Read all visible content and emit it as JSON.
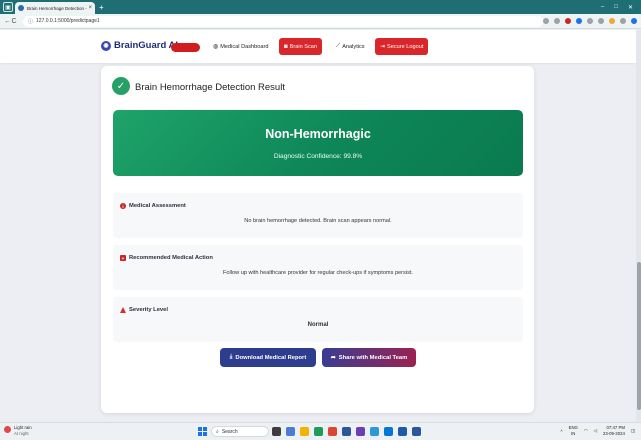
{
  "browser": {
    "tab_title": "Brain Hemorrhage Detection - B",
    "tab_close": "×",
    "new_tab": "+",
    "url": "127.0.0.1:5000/predictpage1",
    "nav_back": "←",
    "nav_reload": "C",
    "window_controls": {
      "minimize": "–",
      "maximize": "□",
      "close": "✕"
    }
  },
  "navbar": {
    "brand": "BrainGuard AI",
    "links": {
      "dashboard": "Medical Dashboard",
      "scan": "Brain Scan",
      "analytics": "Analytics",
      "logout": "Secure Logout"
    }
  },
  "result": {
    "title": "Brain Hemorrhage Detection Result",
    "prediction": "Non-Hemorrhagic",
    "confidence": "Diagnostic Confidence: 99.8%"
  },
  "sections": {
    "assessment": {
      "heading": "Medical Assessment",
      "text": "No brain hemorrhage detected. Brain scan appears normal."
    },
    "action": {
      "heading": "Recommended Medical Action",
      "text": "Follow up with healthcare provider for regular check-ups if symptoms persist."
    },
    "severity": {
      "heading": "Severity Level",
      "text": "Normal"
    }
  },
  "buttons": {
    "download": "Download Medical Report",
    "share": "Share with Medical Team"
  },
  "taskbar": {
    "weather_title": "Light rain",
    "weather_sub": "At night",
    "search_placeholder": "Search",
    "lang_top": "ENG",
    "lang_bottom": "IN",
    "time": "07:47 PM",
    "date": "23-09-2024"
  },
  "colors": {
    "success": "#0e8657",
    "danger": "#d9262b",
    "brand": "#1d2c7a"
  }
}
